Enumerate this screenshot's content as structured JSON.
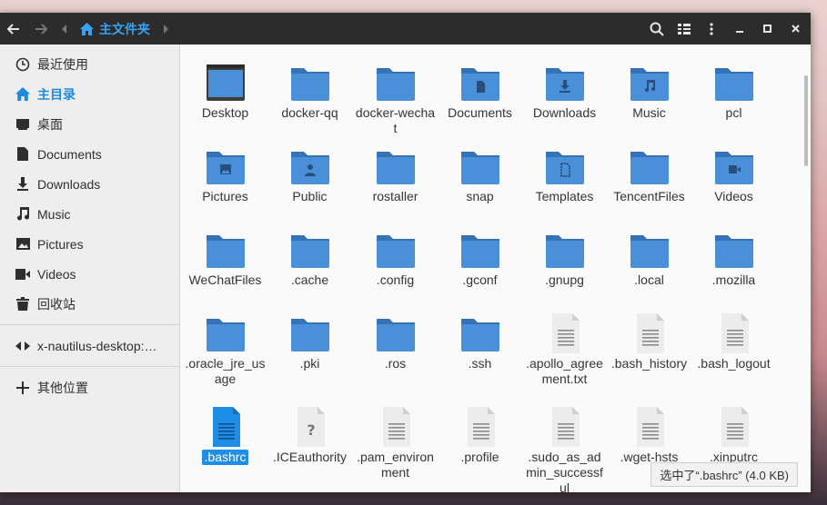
{
  "window": {
    "title": "主文件夹",
    "controls": [
      "minimize",
      "maximize",
      "close"
    ]
  },
  "colors": {
    "accent": "#1d8ae0",
    "folder": "#4a90d9",
    "folder_dark": "#3572b8"
  },
  "sidebar": {
    "items": [
      {
        "label": "最近使用",
        "icon": "clock-icon"
      },
      {
        "label": "主目录",
        "icon": "home-icon",
        "active": true
      },
      {
        "label": "桌面",
        "icon": "desktop-icon"
      },
      {
        "label": "Documents",
        "icon": "document-icon"
      },
      {
        "label": "Downloads",
        "icon": "download-icon"
      },
      {
        "label": "Music",
        "icon": "music-icon"
      },
      {
        "label": "Pictures",
        "icon": "picture-icon"
      },
      {
        "label": "Videos",
        "icon": "video-icon"
      },
      {
        "label": "回收站",
        "icon": "trash-icon"
      },
      {
        "label": "x-nautilus-desktop:…",
        "icon": "eject-icon"
      },
      {
        "label": "其他位置",
        "icon": "plus-icon"
      }
    ]
  },
  "files": [
    {
      "name": "Desktop",
      "type": "desktop"
    },
    {
      "name": "docker-qq",
      "type": "folder"
    },
    {
      "name": "docker-wechat",
      "type": "folder"
    },
    {
      "name": "Documents",
      "type": "folder-doc"
    },
    {
      "name": "Downloads",
      "type": "folder-download"
    },
    {
      "name": "Music",
      "type": "folder-music"
    },
    {
      "name": "pcl",
      "type": "folder"
    },
    {
      "name": "Pictures",
      "type": "folder-picture"
    },
    {
      "name": "Public",
      "type": "folder-public"
    },
    {
      "name": "rostaller",
      "type": "folder"
    },
    {
      "name": "snap",
      "type": "folder"
    },
    {
      "name": "Templates",
      "type": "folder-template"
    },
    {
      "name": "TencentFiles",
      "type": "folder"
    },
    {
      "name": "Videos",
      "type": "folder-video"
    },
    {
      "name": "WeChatFiles",
      "type": "folder"
    },
    {
      "name": ".cache",
      "type": "folder"
    },
    {
      "name": ".config",
      "type": "folder"
    },
    {
      "name": ".gconf",
      "type": "folder"
    },
    {
      "name": ".gnupg",
      "type": "folder"
    },
    {
      "name": ".local",
      "type": "folder"
    },
    {
      "name": ".mozilla",
      "type": "folder"
    },
    {
      "name": ".oracle_jre_usage",
      "type": "folder"
    },
    {
      "name": ".pki",
      "type": "folder"
    },
    {
      "name": ".ros",
      "type": "folder"
    },
    {
      "name": ".ssh",
      "type": "folder"
    },
    {
      "name": ".apollo_agreement.txt",
      "type": "text"
    },
    {
      "name": ".bash_history",
      "type": "text"
    },
    {
      "name": ".bash_logout",
      "type": "text"
    },
    {
      "name": ".bashrc",
      "type": "text-selected",
      "selected": true
    },
    {
      "name": ".ICEauthority",
      "type": "unknown"
    },
    {
      "name": ".pam_environment",
      "type": "text"
    },
    {
      "name": ".profile",
      "type": "text"
    },
    {
      "name": ".sudo_as_admin_successful",
      "type": "text"
    },
    {
      "name": ".wget-hsts",
      "type": "text"
    },
    {
      "name": ".xinputrc",
      "type": "text"
    }
  ],
  "status": "选中了“.bashrc” (4.0 KB)"
}
